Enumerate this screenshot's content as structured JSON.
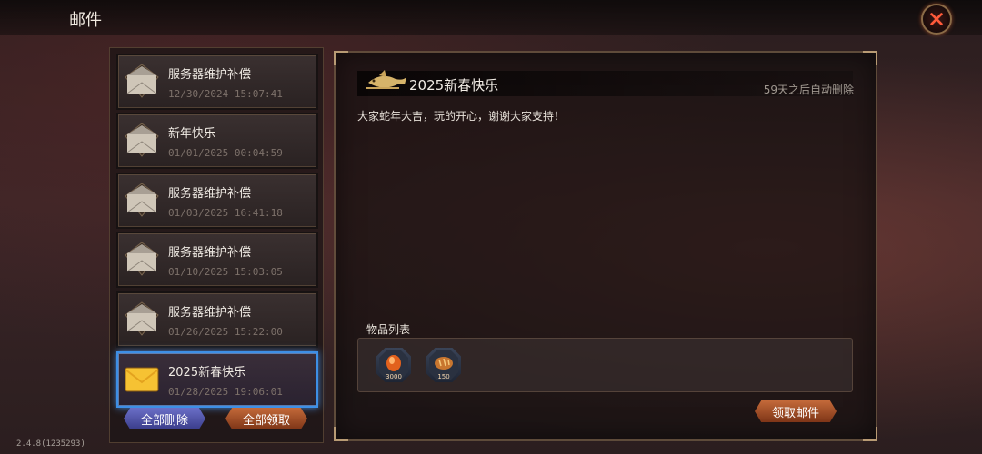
{
  "header": {
    "title": "邮件",
    "close_icon": "close-icon"
  },
  "mails": [
    {
      "subject": "服务器维护补偿",
      "date": "12/30/2024 15:07:41",
      "icon": "envelope-open-icon",
      "selected": false
    },
    {
      "subject": "新年快乐",
      "date": "01/01/2025 00:04:59",
      "icon": "envelope-open-icon",
      "selected": false
    },
    {
      "subject": "服务器维护补偿",
      "date": "01/03/2025 16:41:18",
      "icon": "envelope-open-icon",
      "selected": false
    },
    {
      "subject": "服务器维护补偿",
      "date": "01/10/2025 15:03:05",
      "icon": "envelope-open-icon",
      "selected": false
    },
    {
      "subject": "服务器维护补偿",
      "date": "01/26/2025 15:22:00",
      "icon": "envelope-open-icon",
      "selected": false
    },
    {
      "subject": "2025新春快乐",
      "date": "01/28/2025 19:06:01",
      "icon": "envelope-new-icon",
      "selected": true
    }
  ],
  "list_buttons": {
    "delete_all": "全部删除",
    "claim_all": "全部领取"
  },
  "detail": {
    "title": "2025新春快乐",
    "expire": "59天之后自动删除",
    "body": "大家蛇年大吉，玩的开心，谢谢大家支持！",
    "items_label": "物品列表",
    "items": [
      {
        "icon": "orange-gem-icon",
        "count": "3000"
      },
      {
        "icon": "bread-icon",
        "count": "150"
      }
    ],
    "claim_button": "领取邮件"
  },
  "version": "2.4.8(1235293)",
  "colors": {
    "selected_border": "#3d8fe6",
    "accent_orange": "#c46a3a",
    "accent_blue": "#5a5fc0"
  }
}
